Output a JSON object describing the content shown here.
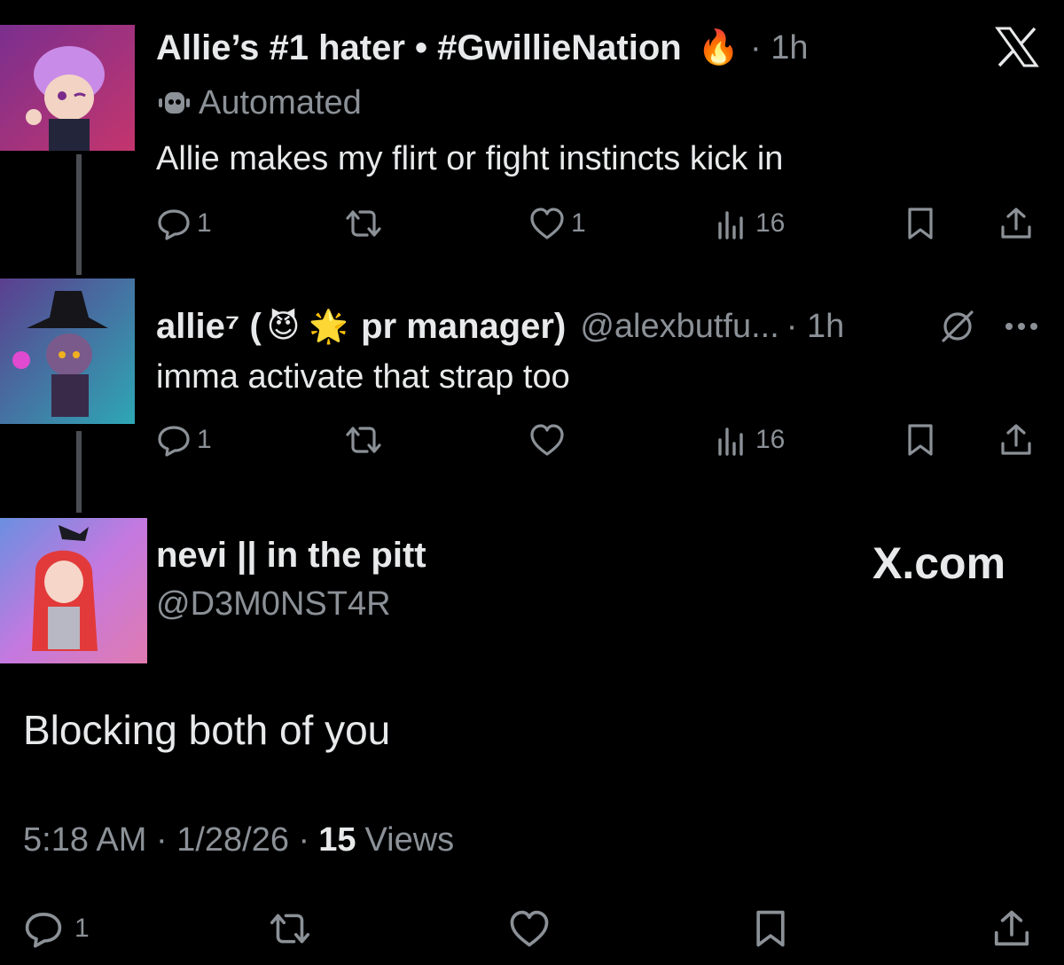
{
  "post1": {
    "author_name": "Allie’s #1 hater • #GwillieNation",
    "author_emoji": "🔥",
    "time": "· 1h",
    "automated_label": "Automated",
    "text": "Allie makes my flirt or fight instincts kick in",
    "replies": "1",
    "likes": "1",
    "views": "16",
    "close_icon": "x-logo-icon"
  },
  "post2": {
    "name_a": "allie⁷ (",
    "emoji_1": "😈",
    "emoji_2": "🌟",
    "name_b": "pr manager)",
    "handle": "@alexbutfu...",
    "time": "· 1h",
    "text": "imma activate that strap too",
    "replies": "1",
    "views": "16"
  },
  "post3": {
    "author_name": "nevi || in the pitt",
    "handle": "@D3M0NST4R",
    "watermark": "X.com",
    "text": "Blocking both of you",
    "time_date": "5:18 AM · 1/28/26 ·",
    "views_count": "15",
    "views_label": "Views",
    "replies": "1"
  }
}
